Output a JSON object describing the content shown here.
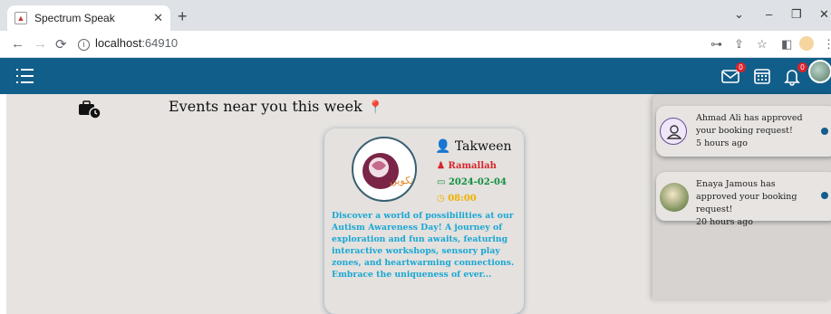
{
  "browser": {
    "tab_title": "Spectrum Speak",
    "url_host": "localhost",
    "url_port": ":64910"
  },
  "appbar": {
    "messages_badge": "0",
    "notifications_badge": "0"
  },
  "main": {
    "heading": "Events near you this week"
  },
  "event_card": {
    "name": "Takween",
    "location": "Ramallah",
    "date": "2024-02-04",
    "time": "08:00",
    "logo_text": "تكوين",
    "description": "Discover a world of possibilities at our Autism Awareness Day! A journey of exploration and fun awaits, featuring interactive workshops, sensory play zones, and heartwarming connections. Embrace the uniqueness of ever..."
  },
  "notifications": [
    {
      "text": "Ahmad Ali has approved your booking request!",
      "time": "5 hours ago"
    },
    {
      "text": "Enaya Jamous has approved your booking request!",
      "time": "20 hours ago"
    }
  ],
  "colors": {
    "appbar": "#125e8a",
    "location": "#d7252b",
    "date": "#0f8f3f",
    "time": "#f0b000",
    "description": "#1aa7d4"
  }
}
